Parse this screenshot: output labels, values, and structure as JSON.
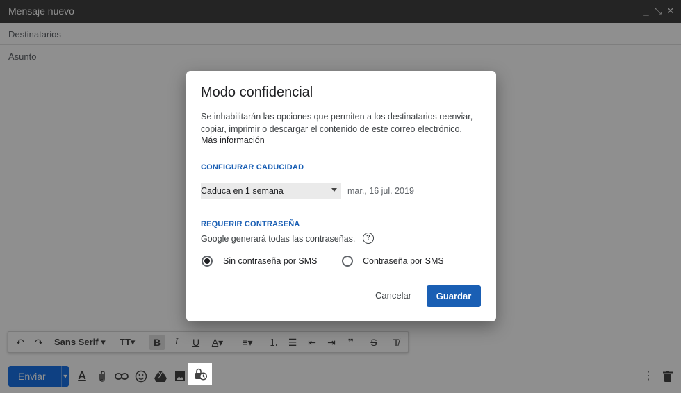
{
  "compose": {
    "title": "Mensaje nuevo",
    "recipients_placeholder": "Destinatarios",
    "subject_placeholder": "Asunto",
    "window_controls": [
      "minimize-icon",
      "fullscreen-icon",
      "close-icon"
    ],
    "font_family": "Sans Serif",
    "send_label": "Enviar"
  },
  "toolbar": {
    "icons": [
      "undo-icon",
      "redo-icon",
      "font-family-select",
      "text-size-icon",
      "bold-icon",
      "italic-icon",
      "underline-icon",
      "text-color-icon",
      "align-icon",
      "numbered-list-icon",
      "bulleted-list-icon",
      "indent-less-icon",
      "indent-more-icon",
      "quote-icon",
      "strikethrough-icon",
      "clear-formatting-icon"
    ]
  },
  "bottom_icons": [
    "formatting-icon",
    "attach-icon",
    "link-icon",
    "emoji-icon",
    "drive-icon",
    "photo-icon",
    "confidential-mode-icon",
    "more-options-icon",
    "delete-icon"
  ],
  "dialog": {
    "title": "Modo confidencial",
    "description": "Se inhabilitarán las opciones que permiten a los destinatarios reenviar, copiar, imprimir o descargar el contenido de este correo electrónico.",
    "learn_more": "Más información",
    "expiry_section": "CONFIGURAR CADUCIDAD",
    "expiry_value": "Caduca en 1 semana",
    "expiry_date": "mar., 16 jul. 2019",
    "password_section": "REQUERIR CONTRASEÑA",
    "password_note": "Google generará todas las contraseñas.",
    "option_no_sms": "Sin contraseña por SMS",
    "option_sms": "Contraseña por SMS",
    "selected_option": "Sin contraseña por SMS",
    "cancel_label": "Cancelar",
    "save_label": "Guardar"
  },
  "colors": {
    "titlebar": "#404040",
    "primary_button": "#1a5fb4",
    "send_button": "#1a73e8",
    "section_heading": "#1a5fb4"
  }
}
